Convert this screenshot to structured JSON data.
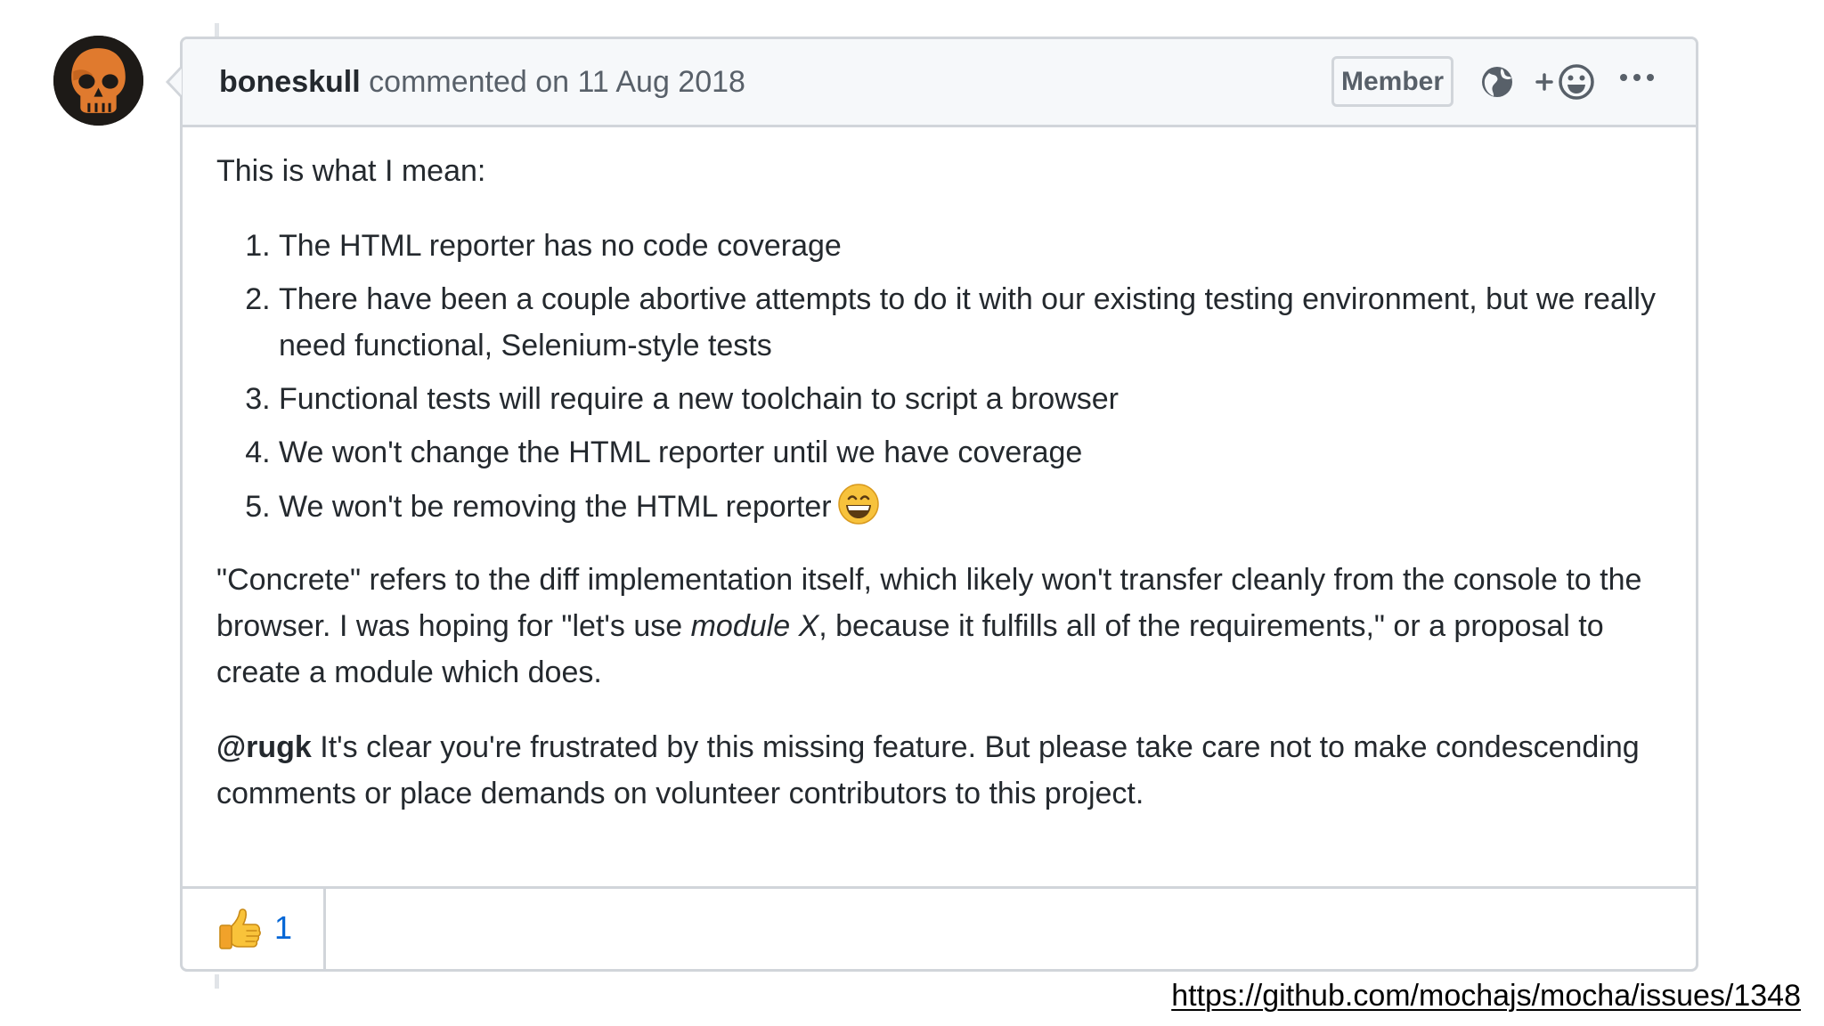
{
  "comment": {
    "author": "boneskull",
    "action_text": "commented on 11 Aug 2018",
    "role_badge": "Member",
    "header_icons": [
      "globe-icon",
      "add-reaction-icon",
      "more-options-icon"
    ],
    "body": {
      "intro": "This is what I mean:",
      "points": [
        "The HTML reporter has no code coverage",
        "There have been a couple abortive attempts to do it with our existing testing environment, but we really need functional, Selenium-style tests",
        "Functional tests will require a new toolchain to script a browser",
        "We won't change the HTML reporter until we have coverage",
        "We won't be removing the HTML reporter"
      ],
      "point5_emoji": "grinning-face-icon",
      "para2_before": "\"Concrete\" refers to the diff implementation itself, which likely won't transfer cleanly from the console to the browser. I was hoping for \"let's use ",
      "para2_emphasis": "module X",
      "para2_after": ", because it fulfills all of the requirements,\" or a proposal to create a module which does.",
      "mention": "@rugk",
      "para3_text": " It's clear you're frustrated by this missing feature. But please take care not to make condescending comments or place demands on volunteer contributors to this project."
    },
    "reactions": [
      {
        "icon": "thumbs-up-icon",
        "count": "1"
      }
    ]
  },
  "source_url": "https://github.com/mochajs/mocha/issues/1348",
  "colors": {
    "header_bg": "#f6f8fa",
    "border": "#d1d5da",
    "text": "#24292e",
    "muted_text": "#586069",
    "link_blue": "#0366d6",
    "avatar_orange": "#e07a2e"
  }
}
